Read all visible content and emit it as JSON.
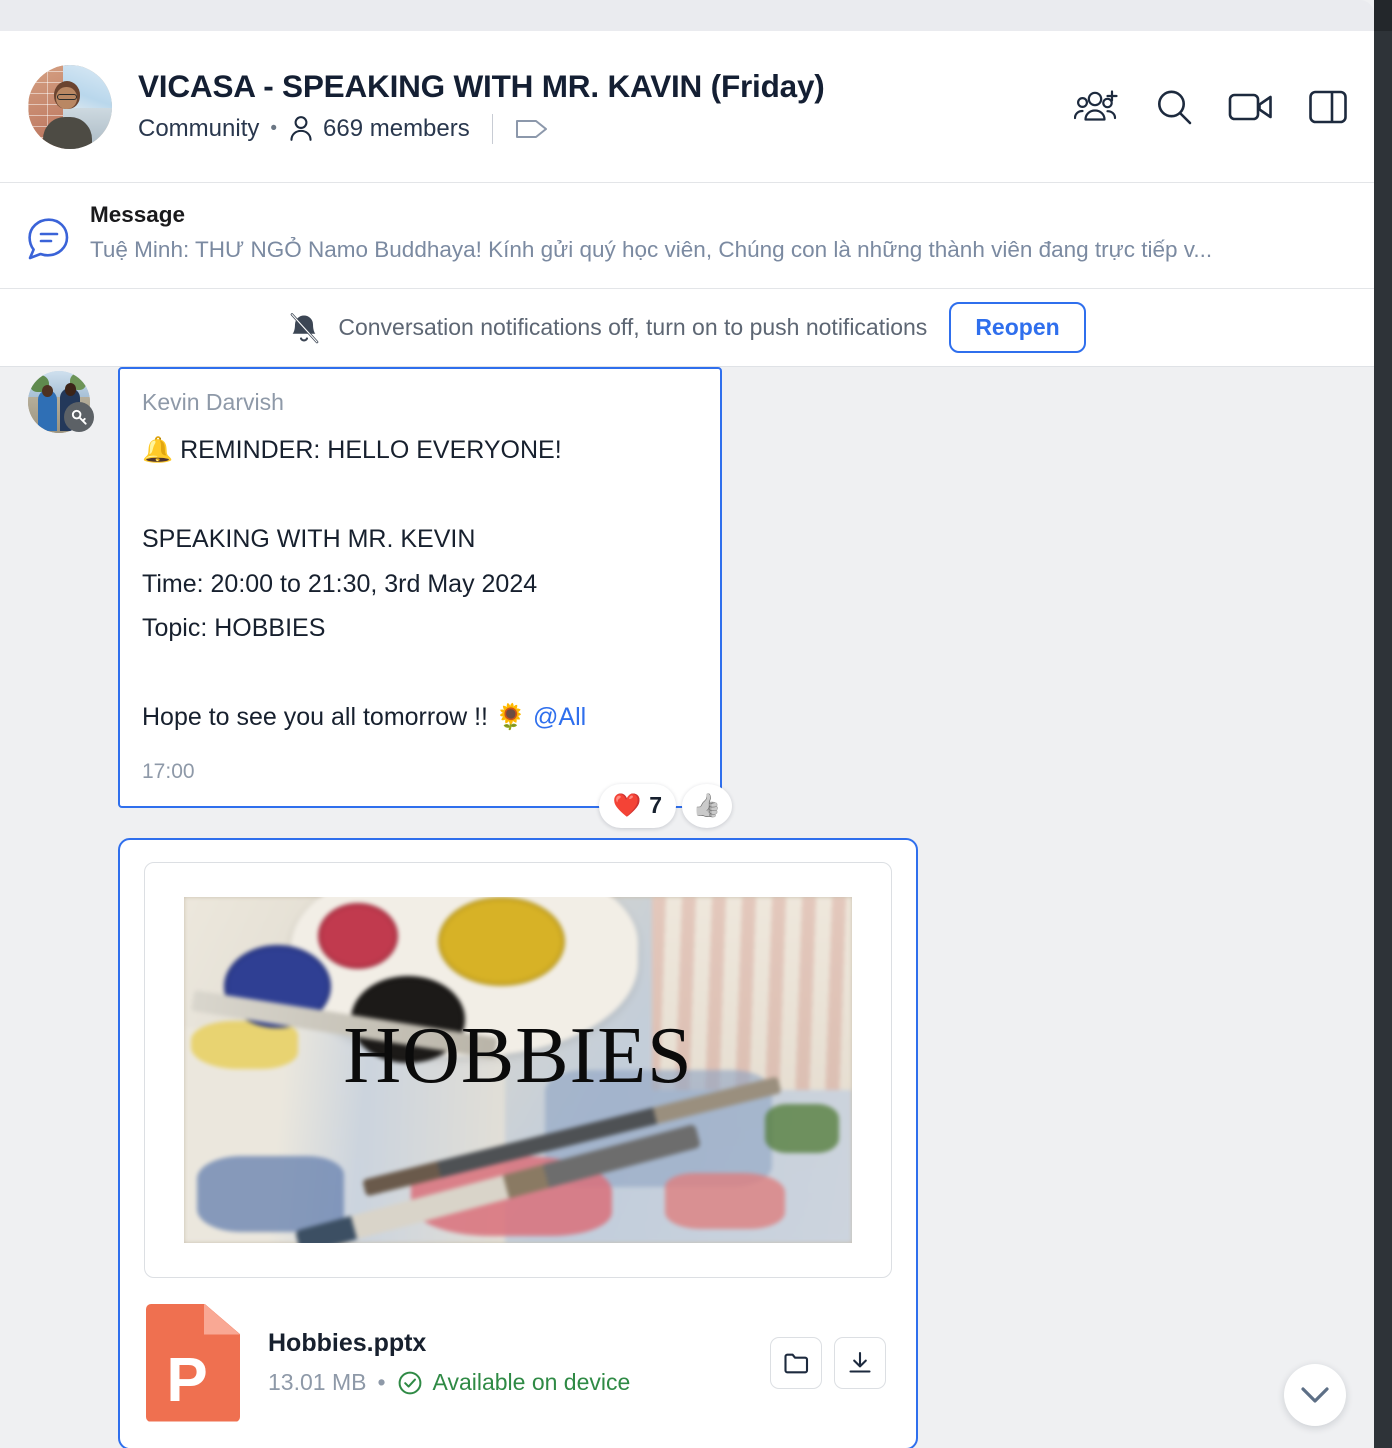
{
  "header": {
    "title": "VICASA - SPEAKING WITH MR. KAVIN (Friday)",
    "community_label": "Community",
    "separator_dot": "•",
    "members": "669 members",
    "icons": {
      "add_member": "add-members-icon",
      "search": "search-icon",
      "video": "video-call-icon",
      "panel": "toggle-panel-icon",
      "tag": "tag-icon",
      "person": "person-icon"
    }
  },
  "pinned": {
    "label": "Message",
    "preview": "Tuệ Minh: THƯ NGỎ Namo Buddhaya! Kính gửi quý học viên, Chúng con là những thành viên đang trực tiếp v...",
    "icon": "message-bubble-icon"
  },
  "notification": {
    "icon": "bell-off-icon",
    "text": "Conversation notifications off, turn on to push notifications",
    "button": "Reopen"
  },
  "messages": [
    {
      "sender": "Kevin Darvish",
      "avatar_badge": "key-icon",
      "body": "🔔 REMINDER: HELLO EVERYONE!\n\nSPEAKING WITH MR. KEVIN\nTime: 20:00 to 21:30, 3rd May 2024\nTopic: HOBBIES\n\nHope to see you all tomorrow !! 🌻 ",
      "mention": "@All",
      "time": "17:00",
      "reactions": [
        {
          "emoji": "❤️",
          "count": "7"
        },
        {
          "emoji": "👍",
          "count": ""
        }
      ]
    }
  ],
  "attachment": {
    "thumbnail_title": "HOBBIES",
    "file_name": "Hobbies.pptx",
    "file_size": "13.01 MB",
    "separator": "•",
    "availability": "Available on device",
    "availability_color": "#2f8a45",
    "file_letter": "P",
    "actions": {
      "open_folder": "folder-icon",
      "download": "download-icon"
    }
  },
  "scroll_button": "chevron-down-icon",
  "colors": {
    "accent": "#2f6fed",
    "chat_background": "#eff0f2",
    "text_primary": "#17202e",
    "text_muted": "#8e99a8",
    "file_icon": "#ef7050"
  }
}
